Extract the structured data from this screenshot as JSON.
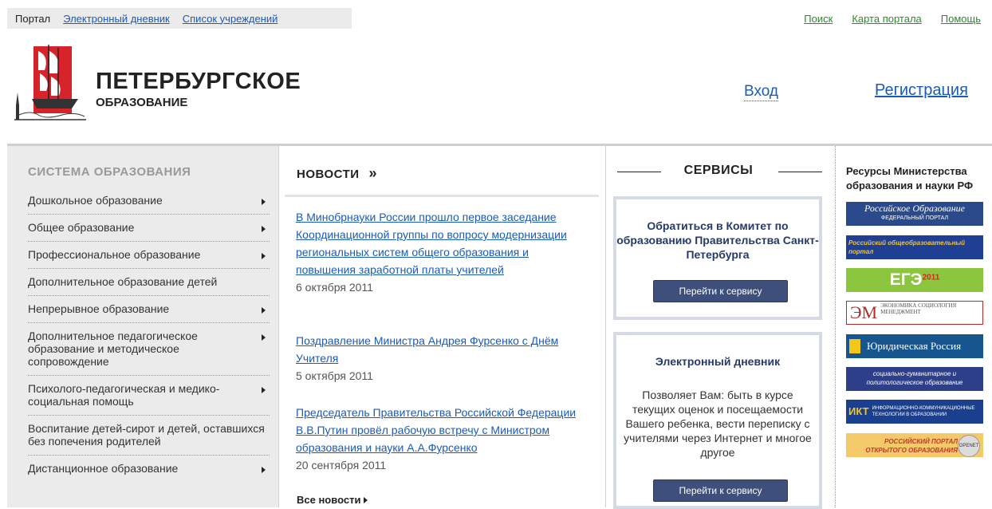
{
  "topnav": {
    "current": "Портал",
    "diary": "Электронный дневник",
    "institutions": "Список учреждений"
  },
  "toplinks": {
    "search": "Поиск",
    "sitemap": "Карта портала",
    "help": "Помощь"
  },
  "logo": {
    "line1": "ПЕТЕРБУРГСКОЕ",
    "line2": "ОБРАЗОВАНИЕ"
  },
  "auth": {
    "login": "Вход",
    "register": "Регистрация"
  },
  "sidebar": {
    "title": "СИСТЕМА ОБРАЗОВАНИЯ",
    "items": [
      {
        "label": "Дошкольное образование",
        "arrow": true
      },
      {
        "label": "Общее образование",
        "arrow": true
      },
      {
        "label": "Профессиональное образование",
        "arrow": true
      },
      {
        "label": "Дополнительное образование детей",
        "arrow": false
      },
      {
        "label": "Непрерывное образование",
        "arrow": true
      },
      {
        "label": "Дополнительное педагогическое образование и методическое сопровождение",
        "arrow": true
      },
      {
        "label": "Психолого-педагогическая и медико-социальная помощь",
        "arrow": true
      },
      {
        "label": "Воспитание детей-сирот и детей, оставшихся без попечения родителей",
        "arrow": false
      },
      {
        "label": "Дистанционное образование",
        "arrow": true
      }
    ]
  },
  "news": {
    "title": "НОВОСТИ",
    "chevron": "»",
    "items": [
      {
        "title": "В Минобрнауки России прошло первое заседание Координационной группы по вопросу модернизации региональных систем общего образования и повышения заработной платы учителей",
        "date": "6 октября 2011"
      },
      {
        "title": "Поздравление Министра Андрея Фурсенко с Днём Учителя",
        "date": "5 октября 2011"
      },
      {
        "title": "Председатель Правительства Российской Федерации В.В.Путин провёл рабочую встречу с Министром образования и науки А.А.Фурсенко",
        "date": "20 сентября 2011"
      }
    ],
    "all": "Все новости"
  },
  "services": {
    "title": "СЕРВИСЫ",
    "items": [
      {
        "title": "Обратиться в Комитет по образованию Правительства Санкт-Петербурга",
        "desc": "",
        "button": "Перейти к сервису"
      },
      {
        "title": "Электронный дневник",
        "desc": "Позволяет Вам: быть в курсе текущих оценок и посещаемости Вашего ребенка, вести переписку с учителями через Интернет и многое другое",
        "button": "Перейти к сервису"
      }
    ]
  },
  "resources": {
    "title": "Ресурсы Министерства образования и науки РФ",
    "banners": [
      {
        "text": "Российское Образование",
        "sub": "ФЕДЕРАЛЬНЫЙ ПОРТАЛ"
      },
      {
        "text": "Российский общеобразовательный портал",
        "sub": ""
      },
      {
        "text": "ЕГЭ",
        "sub": "2011"
      },
      {
        "text": "ЭКОНОМИКА СОЦИОЛОГИЯ МЕНЕДЖМЕНТ",
        "sub": ""
      },
      {
        "text": "Юридическая Россия",
        "sub": ""
      },
      {
        "text": "социально-гуманитарное и политологическое образование",
        "sub": ""
      },
      {
        "text": "ИНФОРМАЦИОННО-КОММУНИКАЦИОННЫЕ ТЕХНОЛОГИИ В ОБРАЗОВАНИИ",
        "sub": "ИКТ"
      },
      {
        "text": "РОССИЙСКИЙ ПОРТАЛ ОТКРЫТОГО ОБРАЗОВАНИЯ",
        "sub": "OPENET"
      }
    ]
  },
  "colors": {
    "link": "#1a5bb8",
    "green_link": "#2c8a2c",
    "sidebar_bg": "#ebebeb",
    "button": "#3d4f7a",
    "logo_red": "#d8232a"
  }
}
